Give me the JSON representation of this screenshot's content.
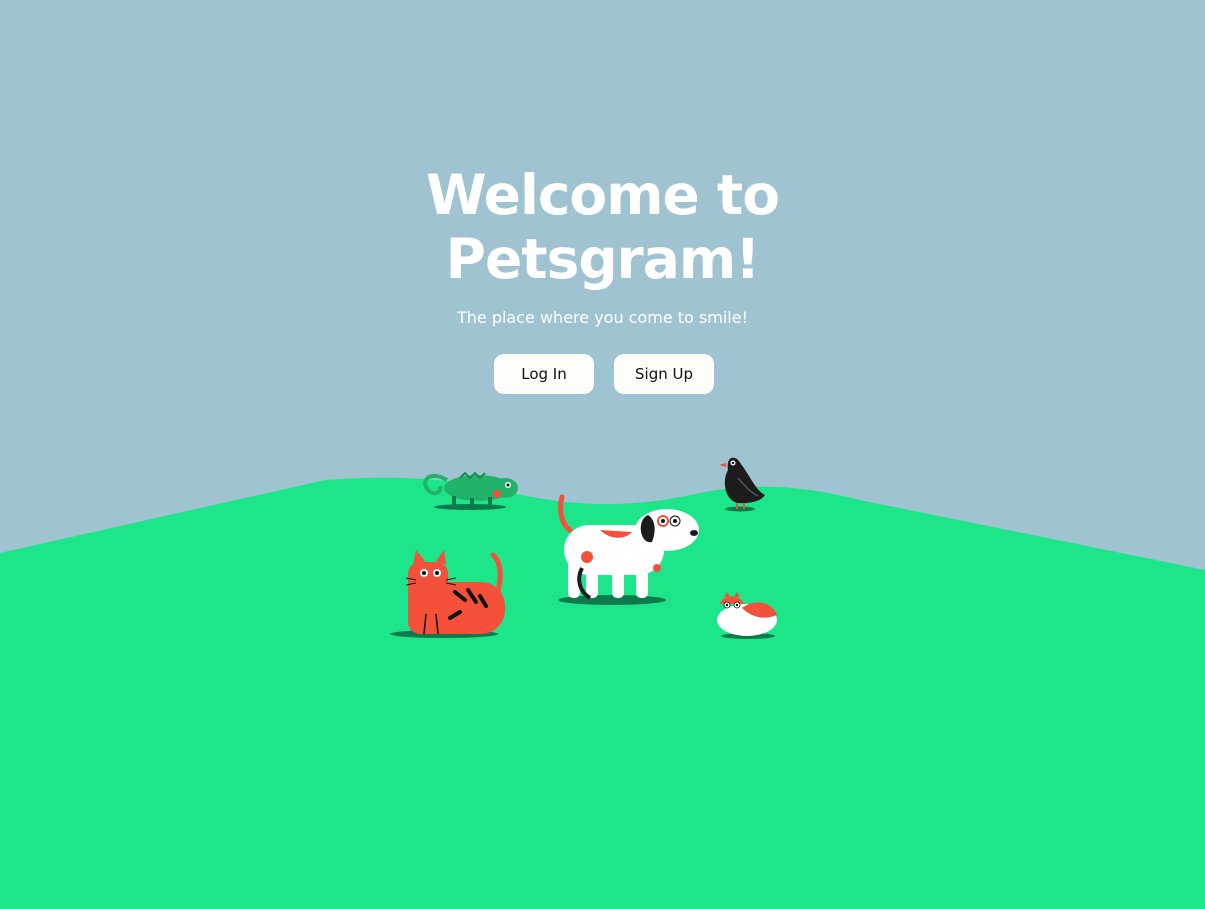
{
  "hero": {
    "title_line1": "Welcome to",
    "title_line2": "Petsgram!",
    "subtitle": "The place where you come to smile!"
  },
  "actions": {
    "login_label": "Log In",
    "signup_label": "Sign Up"
  },
  "colors": {
    "sky": "#9fc3d1",
    "grass": "#1ce58a",
    "button_bg": "#fdfdf9",
    "accent_red": "#f4503a"
  }
}
